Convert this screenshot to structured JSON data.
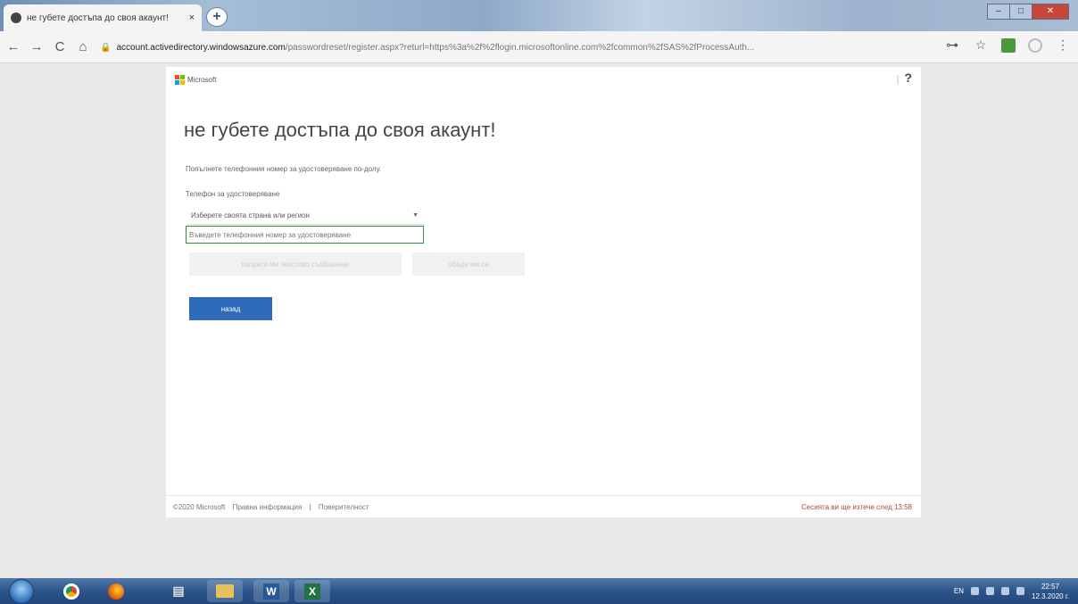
{
  "browser": {
    "tab_title": "не губете достъпа до своя акаунт!",
    "tab_close": "×",
    "new_tab": "+",
    "url_domain": "account.activedirectory.windowsazure.com",
    "url_path": "/passwordreset/register.aspx?returl=https%3a%2f%2flogin.microsoftonline.com%2fcommon%2fSAS%2fProcessAuth...",
    "nav": {
      "back": "←",
      "forward": "→",
      "reload": "C",
      "home": "⌂"
    },
    "key_icon": "⊶",
    "star_icon": "☆",
    "menu_icon": "⋮"
  },
  "page": {
    "logo_text": "Microsoft",
    "help_sep": "|",
    "help_label": "?",
    "title": "не губете достъпа до своя акаунт!",
    "intro": "Попълнете телефонния номер за удостоверяване по-долу.",
    "phone_label": "Телефон за удостоверяване",
    "country_select": "Изберете своята страна или регион",
    "country_caret": "▼",
    "phone_placeholder": "Въведете телефонния номер за удостоверяване",
    "text_button": "изпрати ми текстово съобщение",
    "call_button": "обади ми се",
    "back_button": "назад",
    "footer": {
      "copyright": "©2020 Microsoft",
      "legal": "Правна информация",
      "sep": "|",
      "privacy": "Поверителност",
      "session": "Сесията ви ще изтече след 13:58"
    }
  },
  "taskbar": {
    "language": "EN",
    "time": "22:57",
    "date": "12.3.2020 г."
  },
  "colors": {
    "accent": "#2f6bbd",
    "focus_border": "#2f8a43",
    "session_text": "#b04444"
  }
}
